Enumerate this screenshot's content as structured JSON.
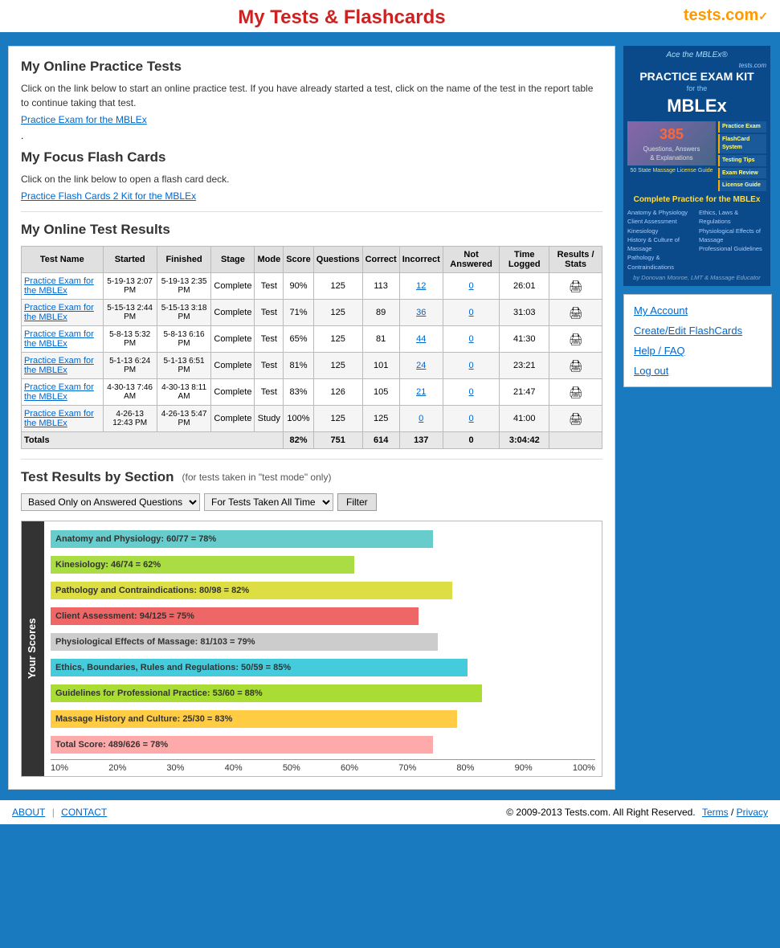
{
  "header": {
    "title": "My Tests & Flashcards",
    "logo": "tests.com"
  },
  "content": {
    "online_tests_title": "My Online Practice Tests",
    "online_tests_desc": "Click on the link below to start an online practice test. If you have already started a test, click on the name of the test in the report table to continue taking that test.",
    "online_tests_link": "Practice Exam for the MBLEx",
    "flashcards_title": "My Focus Flash Cards",
    "flashcards_desc": "Click on the link below to open a flash card deck.",
    "flashcards_link": "Practice Flash Cards 2 Kit for the MBLEx",
    "results_title": "My Online Test Results",
    "table": {
      "headers": [
        "Test Name",
        "Started",
        "Finished",
        "Stage",
        "Mode",
        "Score",
        "Questions",
        "Correct",
        "Incorrect",
        "Not Answered",
        "Time Logged",
        "Results / Stats"
      ],
      "rows": [
        {
          "name": "Practice Exam for the MBLEx",
          "started": "5-19-13 2:07 PM",
          "finished": "5-19-13 2:35 PM",
          "stage": "Complete",
          "mode": "Test",
          "score": "90%",
          "questions": "125",
          "correct": "113",
          "incorrect": "12",
          "not_answered": "0",
          "time": "26:01",
          "has_icon": true
        },
        {
          "name": "Practice Exam for the MBLEx",
          "started": "5-15-13 2:44 PM",
          "finished": "5-15-13 3:18 PM",
          "stage": "Complete",
          "mode": "Test",
          "score": "71%",
          "questions": "125",
          "correct": "89",
          "incorrect": "36",
          "not_answered": "0",
          "time": "31:03",
          "has_icon": true
        },
        {
          "name": "Practice Exam for the MBLEx",
          "started": "5-8-13 5:32 PM",
          "finished": "5-8-13 6:16 PM",
          "stage": "Complete",
          "mode": "Test",
          "score": "65%",
          "questions": "125",
          "correct": "81",
          "incorrect": "44",
          "not_answered": "0",
          "time": "41:30",
          "has_icon": true
        },
        {
          "name": "Practice Exam for the MBLEx",
          "started": "5-1-13 6:24 PM",
          "finished": "5-1-13 6:51 PM",
          "stage": "Complete",
          "mode": "Test",
          "score": "81%",
          "questions": "125",
          "correct": "101",
          "incorrect": "24",
          "not_answered": "0",
          "time": "23:21",
          "has_icon": true
        },
        {
          "name": "Practice Exam for the MBLEx",
          "started": "4-30-13 7:46 AM",
          "finished": "4-30-13 8:11 AM",
          "stage": "Complete",
          "mode": "Test",
          "score": "83%",
          "questions": "126",
          "correct": "105",
          "incorrect": "21",
          "not_answered": "0",
          "time": "21:47",
          "has_icon": true
        },
        {
          "name": "Practice Exam for the MBLEx",
          "started": "4-26-13 12:43 PM",
          "finished": "4-26-13 5:47 PM",
          "stage": "Complete",
          "mode": "Study",
          "score": "100%",
          "questions": "125",
          "correct": "125",
          "incorrect": "0",
          "not_answered": "0",
          "time": "41:00",
          "has_icon": true
        }
      ],
      "totals": {
        "label": "Totals",
        "score": "82%",
        "questions": "751",
        "correct": "614",
        "incorrect": "137",
        "not_answered": "0",
        "time": "3:04:42"
      }
    },
    "section_results_title": "Test Results by Section",
    "section_results_note": "(for tests taken in \"test mode\" only)",
    "filter_dropdown1": "Based Only on Answered Questions",
    "filter_dropdown2": "For Tests Taken All Time",
    "filter_button": "Filter",
    "y_axis_label": "Your Scores",
    "bars": [
      {
        "label": "Anatomy and Physiology: 60/77 = 78%",
        "percent": 78,
        "color": "#66cccc"
      },
      {
        "label": "Kinesiology: 46/74 = 62%",
        "percent": 62,
        "color": "#aadd44"
      },
      {
        "label": "Pathology and Contraindications: 80/98 = 82%",
        "percent": 82,
        "color": "#dddd44"
      },
      {
        "label": "Client Assessment: 94/125 = 75%",
        "percent": 75,
        "color": "#ee6666"
      },
      {
        "label": "Physiological Effects of Massage: 81/103 = 79%",
        "percent": 79,
        "color": "#cccccc"
      },
      {
        "label": "Ethics, Boundaries, Rules and Regulations: 50/59 = 85%",
        "percent": 85,
        "color": "#44ccdd"
      },
      {
        "label": "Guidelines for Professional Practice: 53/60 = 88%",
        "percent": 88,
        "color": "#aadd33"
      },
      {
        "label": "Massage History and Culture: 25/30 = 83%",
        "percent": 83,
        "color": "#ffcc44"
      },
      {
        "label": "Total Score: 489/626 = 78%",
        "percent": 78,
        "color": "#ffaaaa"
      }
    ],
    "x_axis_labels": [
      "10%",
      "20%",
      "30%",
      "40%",
      "50%",
      "60%",
      "70%",
      "80%",
      "90%",
      "100%"
    ]
  },
  "sidebar": {
    "nav_links": [
      "My Account",
      "Create/Edit FlashCards",
      "Help / FAQ",
      "Log out"
    ],
    "ad": {
      "ace": "Ace the MBLEx®",
      "practice_exam": "PRACTICE EXAM KIT",
      "for_the": "for the",
      "product": "MBLEx",
      "questions": "385",
      "desc": "Questions, Answers & Explanations",
      "complete": "Complete Practice for the MBLEx",
      "right_items": [
        "Practice Exam",
        "FlashCard System",
        "Testing Tips",
        "Exam Review",
        "License Guide"
      ],
      "topics": [
        "Anatomy & Physiology",
        "Kinesiology",
        "Pathology & Contraindications",
        "Physiological Effects of Massage",
        "Client Assessment",
        "History & Culture of Massage",
        "Ethics, Laws & Regulations",
        "Professional Guidelines"
      ],
      "author": "by Donovan Monroe, LMT & Massage Educator",
      "state_guide": "50 State Massage License Guide"
    }
  },
  "footer": {
    "links": [
      "ABOUT",
      "CONTACT"
    ],
    "copyright": "© 2009-2013 Tests.com. All Right Reserved.",
    "terms": "Terms",
    "privacy": "Privacy"
  }
}
